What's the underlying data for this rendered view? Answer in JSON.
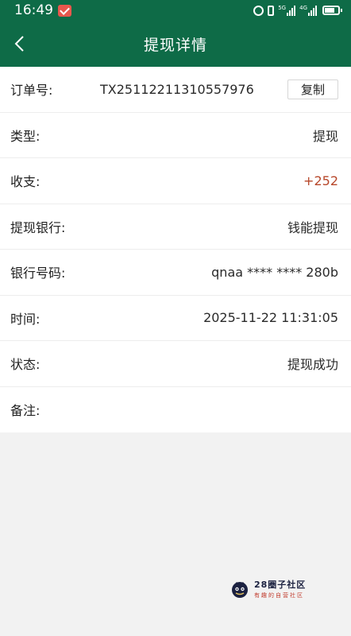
{
  "status_bar": {
    "time": "16:49",
    "signal1_label": "5G",
    "signal2_label": "4G"
  },
  "header": {
    "title": "提现详情"
  },
  "order": {
    "label": "订单号:",
    "value": "TX25112211310557976",
    "copy_label": "复制"
  },
  "rows": [
    {
      "label": "类型:",
      "value": "提现"
    },
    {
      "label": "收支:",
      "value": "+252"
    },
    {
      "label": "提现银行:",
      "value": "钱能提现"
    },
    {
      "label": "银行号码:",
      "value": "qnaa **** **** 280b"
    },
    {
      "label": "时间:",
      "value": "2025-11-22 11:31:05"
    },
    {
      "label": "状态:",
      "value": "提现成功"
    },
    {
      "label": "备注:",
      "value": ""
    }
  ],
  "watermark": {
    "title": "28圈子社区",
    "subtitle": "有趣的自营社区"
  },
  "colors": {
    "header_bg": "#0e6b47",
    "amount_positive": "#b7472a"
  },
  "icons": [
    "back-arrow-icon",
    "mail-notification-icon",
    "alarm-icon",
    "vibrate-icon",
    "signal-icon",
    "battery-icon"
  ]
}
